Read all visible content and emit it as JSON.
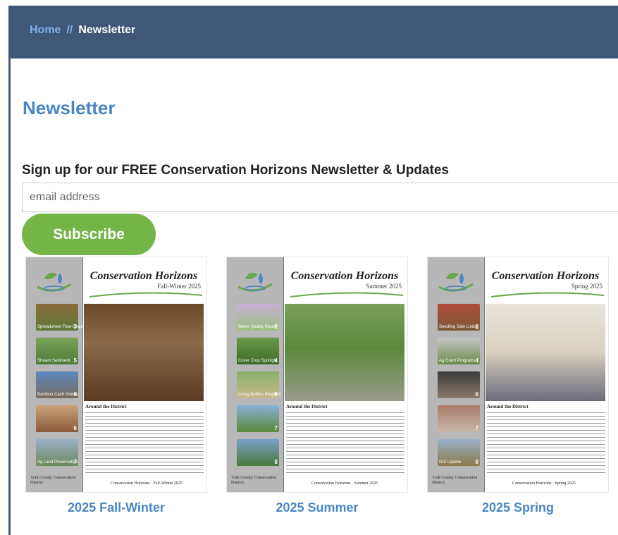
{
  "breadcrumb": {
    "home": "Home",
    "separator": "//",
    "current": "Newsletter"
  },
  "page_title": "Newsletter",
  "signup": {
    "heading": "Sign up for our FREE Conservation Horizons Newsletter & Updates",
    "email_placeholder": "email address",
    "subscribe_label": "Subscribe"
  },
  "colors": {
    "header": "#3f5878",
    "accent_blue": "#4a86c5",
    "button_green": "#75b447"
  },
  "newsletters": [
    {
      "caption": "2025 Fall-Winter",
      "masthead": "Conservation Horizons",
      "season": "Fall-Winter 2025",
      "section": "Around the District",
      "district": "York County Conservation District",
      "footer": "Conservation Horizons · Fall-Winter 2025",
      "sidebar": [
        {
          "label": "Spreadsheet Flow Graphs",
          "num": "3"
        },
        {
          "label": "Stream Sediment",
          "num": "5"
        },
        {
          "label": "Bamboo Cash Grants",
          "num": "6"
        },
        {
          "label": "",
          "num": "6"
        },
        {
          "label": "Ag Land Preservation",
          "num": "7"
        }
      ]
    },
    {
      "caption": "2025 Summer",
      "masthead": "Conservation Horizons",
      "season": "Summer 2025",
      "section": "Around the District",
      "district": "York County Conservation District",
      "footer": "Conservation Horizons · Summer 2025",
      "sidebar": [
        {
          "label": "Water Quality Report",
          "num": "2"
        },
        {
          "label": "Cover Crop Spotlight",
          "num": "4"
        },
        {
          "label": "Living Buffers Program",
          "num": "6"
        },
        {
          "label": "",
          "num": "7"
        },
        {
          "label": "",
          "num": "8"
        }
      ]
    },
    {
      "caption": "2025 Spring",
      "masthead": "Conservation Horizons",
      "season": "Spring 2025",
      "section": "Around the District",
      "district": "York County Conservation District",
      "footer": "Conservation Horizons · Spring 2025",
      "sidebar": [
        {
          "label": "Seedling Sale Listing",
          "num": "2"
        },
        {
          "label": "Ag Grant Programs",
          "num": "4"
        },
        {
          "label": "",
          "num": "6"
        },
        {
          "label": "",
          "num": "7"
        },
        {
          "label": "GIS Update",
          "num": "8"
        }
      ]
    }
  ]
}
